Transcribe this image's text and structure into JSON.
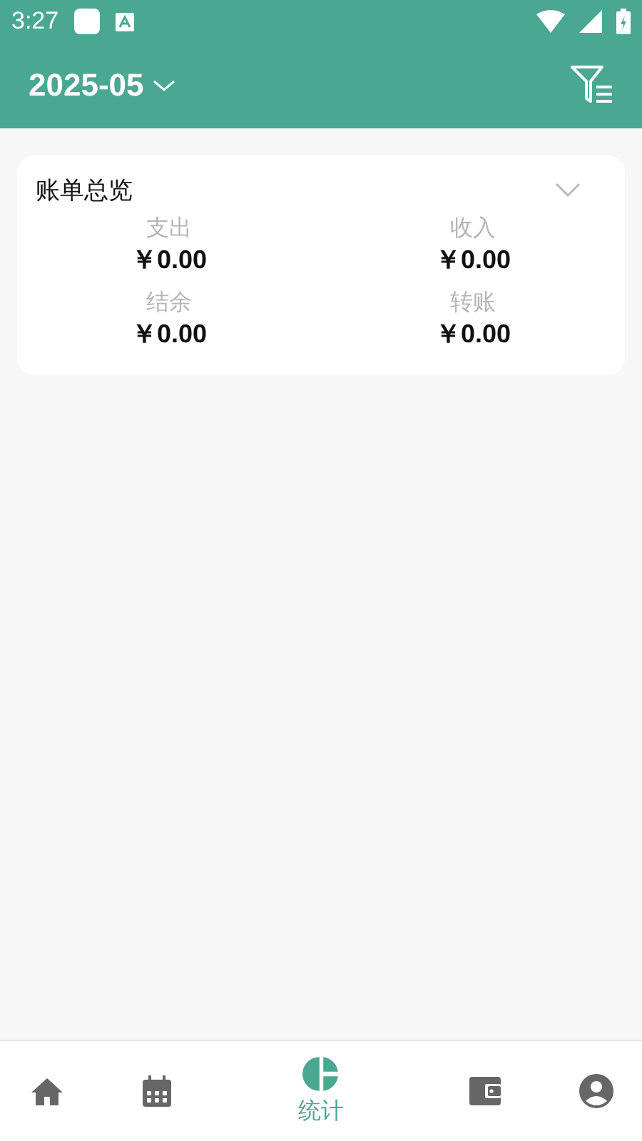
{
  "status_bar": {
    "time": "3:27"
  },
  "header": {
    "month": "2025-05"
  },
  "summary": {
    "title": "账单总览",
    "expanded": false,
    "items": [
      {
        "label": "支出",
        "amount": "￥0.00"
      },
      {
        "label": "收入",
        "amount": "￥0.00"
      },
      {
        "label": "结余",
        "amount": "￥0.00"
      },
      {
        "label": "转账",
        "amount": "￥0.00"
      }
    ]
  },
  "bottom_nav": [
    {
      "kind": "home",
      "selected": false
    },
    {
      "kind": "calendar",
      "selected": false
    },
    {
      "kind": "chart",
      "selected": true,
      "label": "统计"
    },
    {
      "kind": "wallet",
      "selected": false
    },
    {
      "kind": "profile",
      "selected": false
    }
  ]
}
